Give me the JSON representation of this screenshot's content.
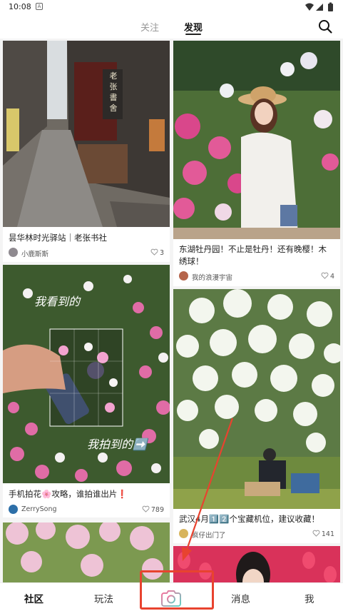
{
  "status_bar": {
    "time": "10:08",
    "badge": "A"
  },
  "top_nav": {
    "tabs": [
      {
        "label": "关注"
      },
      {
        "label": "发现"
      }
    ]
  },
  "feed": [
    {
      "title": "昙华林时光驿站｜老张书社",
      "author": "小鹿斯斯",
      "likes": "3",
      "image_text": [
        "老",
        "张",
        "書",
        "舍"
      ]
    },
    {
      "title": "东湖牡丹园！不止是牡丹！还有晚樱！木绣球！",
      "author": "我的浪漫宇宙",
      "likes": "4"
    },
    {
      "title": "手机拍花🌸攻略，谁拍谁出片❗",
      "author": "ZerrySong",
      "likes": "789",
      "overlay_top": "我看到的",
      "overlay_bottom": "我拍到的➡️"
    },
    {
      "title": "武汉4月1️⃣2️⃣个宝藏机位，建议收藏！",
      "author": "疯仔出门了",
      "likes": "141"
    }
  ],
  "bottom_nav": {
    "community": "社区",
    "play": "玩法",
    "messages": "消息",
    "me": "我"
  },
  "colors": {
    "annotation": "#e8432f",
    "camera_gradient_start": "#ff6b9a",
    "camera_gradient_end": "#5fd3c6"
  }
}
